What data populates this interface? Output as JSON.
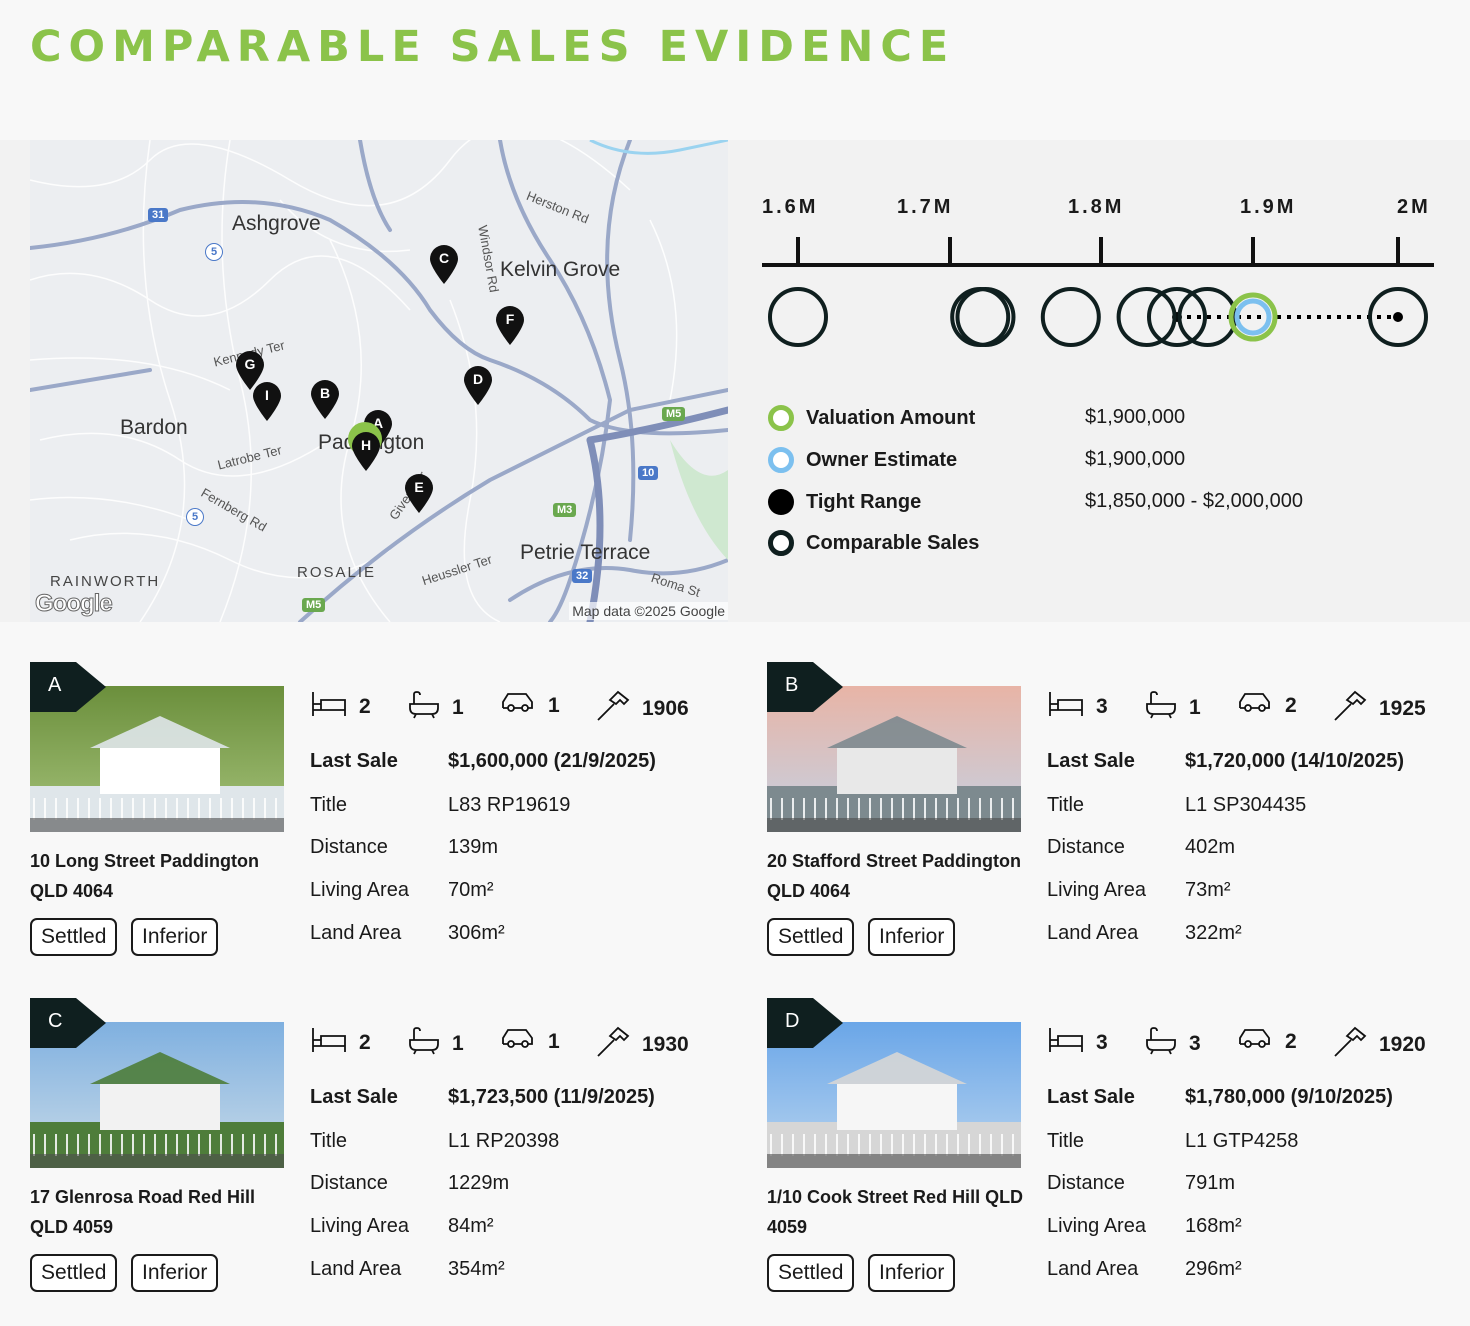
{
  "title": "COMPARABLE SALES EVIDENCE",
  "colors": {
    "accent": "#8bc34a",
    "dark": "#0f1f1f",
    "owner": "#7cc0ef"
  },
  "map": {
    "suburbs": [
      "Ashgrove",
      "Kelvin Grove",
      "Bardon",
      "Paddington",
      "Petrie Terrace",
      "RAINWORTH",
      "ROSALIE"
    ],
    "streets": [
      "Herston Rd",
      "Windsor Rd",
      "Kennedy Ter",
      "Latrobe Ter",
      "Fernberg Rd",
      "Given Ter",
      "Heussler Ter",
      "Roma St"
    ],
    "shields": [
      "31",
      "5",
      "5",
      "M5",
      "M5",
      "M3",
      "10",
      "32"
    ],
    "pins": [
      "A",
      "B",
      "C",
      "D",
      "E",
      "F",
      "G",
      "H",
      "I"
    ],
    "logo": "Google",
    "attribution": "Map data ©2025 Google"
  },
  "scale": {
    "ticks": [
      "1.6M",
      "1.7M",
      "1.8M",
      "1.9M",
      "2M"
    ],
    "tick_values": [
      1600000,
      1700000,
      1800000,
      1900000,
      2000000
    ],
    "comparable_values": [
      1600000,
      1720000,
      1723500,
      1780000,
      1830000,
      1850000,
      1870000
    ],
    "valuation": 1900000,
    "tight_range": [
      1850000,
      2000000
    ]
  },
  "legend": [
    {
      "label": "Valuation Amount",
      "value": "$1,900,000",
      "icon": "valuation-ring"
    },
    {
      "label": "Owner Estimate",
      "value": "$1,900,000",
      "icon": "owner-ring"
    },
    {
      "label": "Tight Range",
      "value": "$1,850,000 - $2,000,000",
      "icon": "tight-range-dot"
    },
    {
      "label": "Comparable Sales",
      "value": "",
      "icon": "comparable-ring"
    }
  ],
  "cards": [
    {
      "letter": "A",
      "beds": "2",
      "baths": "1",
      "cars": "1",
      "year": "1906",
      "address": "10 Long Street Paddington QLD 4064",
      "last_sale_label": "Last Sale",
      "last_sale": "$1,600,000 (21/9/2025)",
      "title_label": "Title",
      "title": "L83 RP19619",
      "distance_label": "Distance",
      "distance": "139m",
      "living_label": "Living Area",
      "living": "70m²",
      "land_label": "Land Area",
      "land": "306m²",
      "status": "Settled",
      "comparison": "Inferior"
    },
    {
      "letter": "B",
      "beds": "3",
      "baths": "1",
      "cars": "2",
      "year": "1925",
      "address": "20 Stafford Street Paddington QLD 4064",
      "last_sale_label": "Last Sale",
      "last_sale": "$1,720,000 (14/10/2025)",
      "title_label": "Title",
      "title": "L1 SP304435",
      "distance_label": "Distance",
      "distance": "402m",
      "living_label": "Living Area",
      "living": "73m²",
      "land_label": "Land Area",
      "land": "322m²",
      "status": "Settled",
      "comparison": "Inferior"
    },
    {
      "letter": "C",
      "beds": "2",
      "baths": "1",
      "cars": "1",
      "year": "1930",
      "address": "17 Glenrosa Road Red Hill QLD 4059",
      "last_sale_label": "Last Sale",
      "last_sale": "$1,723,500 (11/9/2025)",
      "title_label": "Title",
      "title": "L1 RP20398",
      "distance_label": "Distance",
      "distance": "1229m",
      "living_label": "Living Area",
      "living": "84m²",
      "land_label": "Land Area",
      "land": "354m²",
      "status": "Settled",
      "comparison": "Inferior"
    },
    {
      "letter": "D",
      "beds": "3",
      "baths": "3",
      "cars": "2",
      "year": "1920",
      "address": "1/10 Cook Street Red Hill QLD 4059",
      "last_sale_label": "Last Sale",
      "last_sale": "$1,780,000 (9/10/2025)",
      "title_label": "Title",
      "title": "L1 GTP4258",
      "distance_label": "Distance",
      "distance": "791m",
      "living_label": "Living Area",
      "living": "168m²",
      "land_label": "Land Area",
      "land": "296m²",
      "status": "Settled",
      "comparison": "Inferior"
    }
  ]
}
